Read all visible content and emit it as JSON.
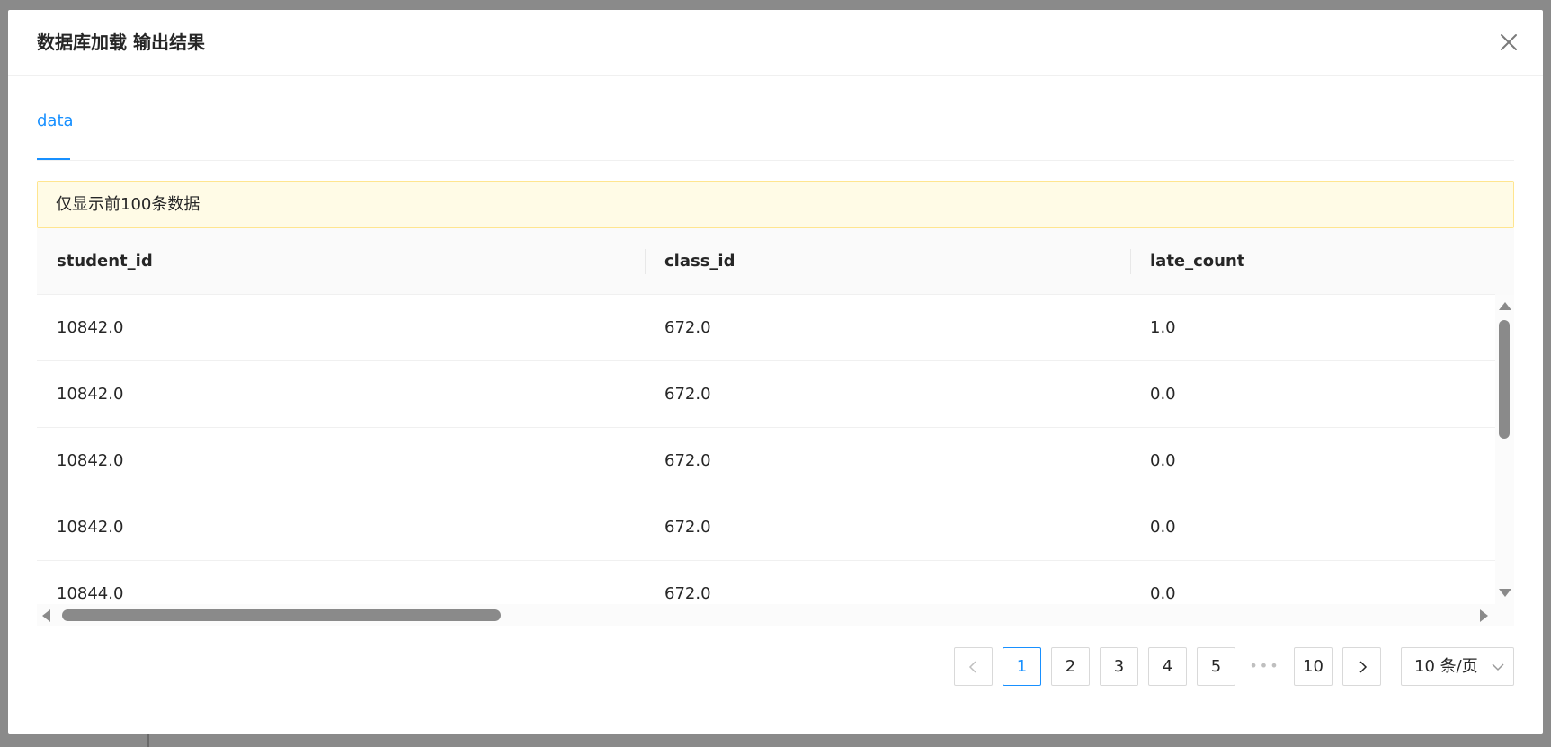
{
  "modal": {
    "title": "数据库加载 输出结果",
    "close_icon": "close-icon"
  },
  "tabs": [
    {
      "label": "data",
      "active": true
    }
  ],
  "alert": {
    "text": "仅显示前100条数据",
    "background": "#fffbe6",
    "border": "#ffe58f"
  },
  "table": {
    "columns": [
      "student_id",
      "class_id",
      "late_count"
    ],
    "rows": [
      [
        "10842.0",
        "672.0",
        "1.0"
      ],
      [
        "10842.0",
        "672.0",
        "0.0"
      ],
      [
        "10842.0",
        "672.0",
        "0.0"
      ],
      [
        "10842.0",
        "672.0",
        "0.0"
      ],
      [
        "10844.0",
        "672.0",
        "0.0"
      ]
    ]
  },
  "pagination": {
    "prev_icon": "chevron-left-icon",
    "next_icon": "chevron-right-icon",
    "pages": [
      "1",
      "2",
      "3",
      "4",
      "5"
    ],
    "ellipsis": "•••",
    "last_page": "10",
    "current_page": "1",
    "page_size_label": "10 条/页",
    "page_size_icon": "chevron-down-icon"
  },
  "colors": {
    "accent": "#1890ff",
    "overlay": "#8a8a8a"
  }
}
